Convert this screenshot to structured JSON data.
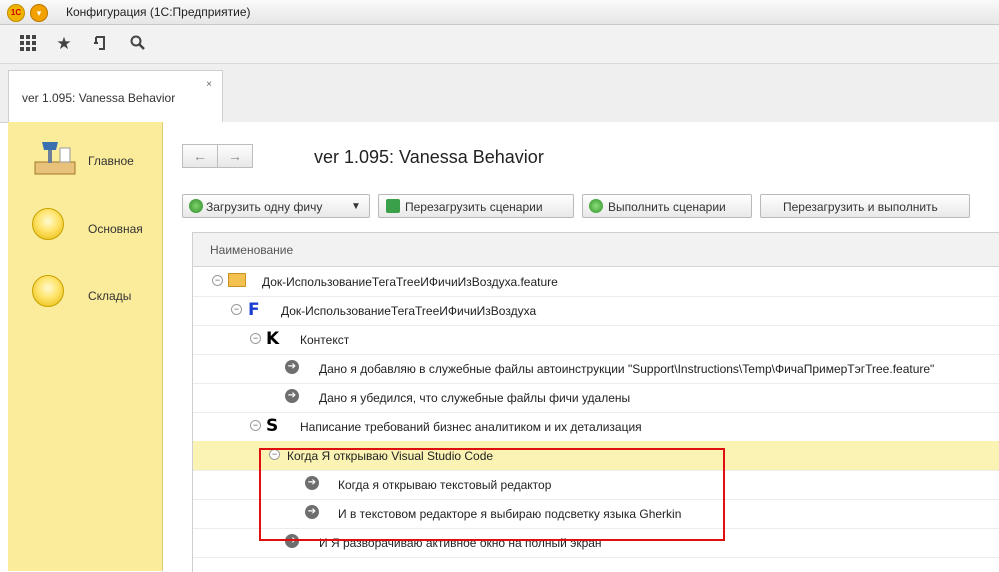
{
  "window": {
    "title": "Конфигурация (1С:Предприятие)",
    "logo_text": "1С"
  },
  "toolbar": {
    "icons": [
      "apps-grid-icon",
      "star-icon",
      "history-icon",
      "search-icon"
    ]
  },
  "tab": {
    "label": "ver 1.095: Vanessa Behavior",
    "close": "×"
  },
  "sidebar": {
    "items": [
      {
        "label": "Главное",
        "icon": "desk-lamp-icon"
      },
      {
        "label": "Основная",
        "icon": "yellow-ball-icon"
      },
      {
        "label": "Склады",
        "icon": "yellow-ball-icon"
      }
    ]
  },
  "form": {
    "title": "ver 1.095: Vanessa Behavior",
    "nav": {
      "back": "←",
      "forward": "→"
    },
    "buttons": {
      "load_one": "Загрузить одну фичу",
      "reload": "Перезагрузить сценарии",
      "run": "Выполнить сценарии",
      "reload_run": "Перезагрузить и выполнить"
    }
  },
  "tree": {
    "header": "Наименование",
    "rows": [
      {
        "text": "Док-ИспользованиеТегаTreeИФичиИзВоздуха.feature",
        "kind": "folder"
      },
      {
        "text": "Док-ИспользованиеТегаTreeИФичиИзВоздуха",
        "kind": "feature",
        "letter": "F"
      },
      {
        "text": "Контекст",
        "kind": "context",
        "letter": "K"
      },
      {
        "text": "Дано я добавляю в служебные файлы автоинструкции \"Support\\Instructions\\Temp\\ФичаПримерТэгTree.feature\"",
        "kind": "step"
      },
      {
        "text": "Дано я убедился, что служебные файлы фичи удалены",
        "kind": "step"
      },
      {
        "text": "Написание требований бизнес аналитиком и их детализация",
        "kind": "scenario",
        "letter": "S"
      },
      {
        "text": "Когда Я открываю Visual Studio Code",
        "kind": "group"
      },
      {
        "text": "Когда я открываю текстовый редактор",
        "kind": "step"
      },
      {
        "text": "И в текстовом редакторе я выбираю подсветку языка Gherkin",
        "kind": "step"
      },
      {
        "text": "И Я разворачиваю активное окно на полный экран",
        "kind": "step"
      }
    ]
  },
  "colors": {
    "sidebar_bg": "#fbec9b",
    "selected_row": "#fbf3b4",
    "annotation": "#e01010"
  }
}
